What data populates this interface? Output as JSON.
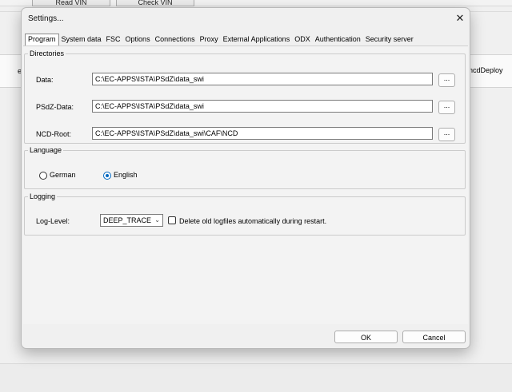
{
  "background": {
    "button_left": "Read VIN",
    "button_right": "Check VIN",
    "left_text": "e",
    "right_text": "ncdDeploy"
  },
  "dialog": {
    "title": "Settings...",
    "close_glyph": "✕",
    "tabs": [
      {
        "label": "Program",
        "active": true
      },
      {
        "label": "System data"
      },
      {
        "label": "FSC"
      },
      {
        "label": "Options"
      },
      {
        "label": "Connections"
      },
      {
        "label": "Proxy"
      },
      {
        "label": "External Applications"
      },
      {
        "label": "ODX"
      },
      {
        "label": "Authentication"
      },
      {
        "label": "Security server"
      }
    ],
    "directories": {
      "legend": "Directories",
      "browse_label": "...",
      "data_label": "Data:",
      "data_value": "C:\\EC-APPS\\ISTA\\PSdZ\\data_swi",
      "psdz_label": "PSdZ-Data:",
      "psdz_value": "C:\\EC-APPS\\ISTA\\PSdZ\\data_swi",
      "ncd_label": "NCD-Root:",
      "ncd_value": "C:\\EC-APPS\\ISTA\\PSdZ\\data_swi\\CAF\\NCD"
    },
    "language": {
      "legend": "Language",
      "german": "German",
      "english": "English",
      "selected": "English"
    },
    "logging": {
      "legend": "Logging",
      "level_label": "Log-Level:",
      "level_value": "DEEP_TRACE",
      "delete_label": "Delete old logfiles automatically during restart.",
      "delete_checked": false
    },
    "ok_label": "OK",
    "cancel_label": "Cancel"
  },
  "colors": {
    "accent": "#0067c0",
    "dialog_bg": "#f0f0f0"
  }
}
